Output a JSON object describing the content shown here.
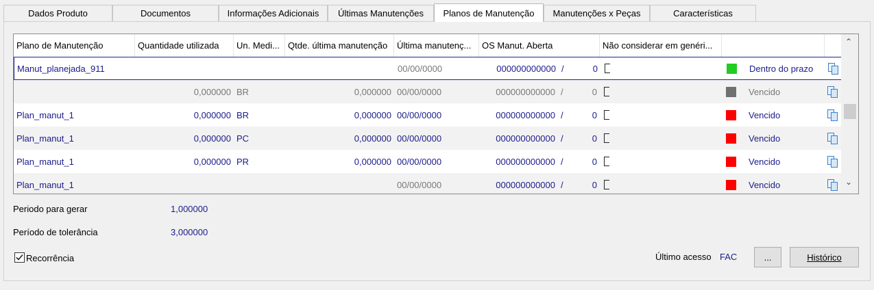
{
  "tabs": [
    {
      "label": "Dados Produto"
    },
    {
      "label": "Documentos"
    },
    {
      "label": "Informações Adicionais"
    },
    {
      "label": "Últimas Manutenções"
    },
    {
      "label": "Planos de Manutenção"
    },
    {
      "label": "Manutenções x Peças"
    },
    {
      "label": "Características"
    }
  ],
  "grid": {
    "columns": [
      "Plano de Manutenção",
      "Quantidade utilizada",
      "Un. Medi...",
      "Qtde. última manutenção",
      "Última manutenç...",
      "OS Manut. Aberta",
      "Não considerar em genéri..."
    ],
    "rows": [
      {
        "plano": "Manut_planejada_911",
        "qtd": "",
        "un": "",
        "qtde_ult": "",
        "ult_data": "00/00/0000",
        "os": "000000000000",
        "sep": "/",
        "os2": "0",
        "status": "Dentro do prazo",
        "color": "#22cc22"
      },
      {
        "plano": "",
        "qtd": "0,000000",
        "un": "BR",
        "qtde_ult": "0,000000",
        "ult_data": "00/00/0000",
        "os": "000000000000",
        "sep": "/",
        "os2": "0",
        "status": "Vencido",
        "color": "#707070"
      },
      {
        "plano": "Plan_manut_1",
        "qtd": "0,000000",
        "un": "BR",
        "qtde_ult": "0,000000",
        "ult_data": "00/00/0000",
        "os": "000000000000",
        "sep": "/",
        "os2": "0",
        "status": "Vencido",
        "color": "#ff0000"
      },
      {
        "plano": "Plan_manut_1",
        "qtd": "0,000000",
        "un": "PC",
        "qtde_ult": "0,000000",
        "ult_data": "00/00/0000",
        "os": "000000000000",
        "sep": "/",
        "os2": "0",
        "status": "Vencido",
        "color": "#ff0000"
      },
      {
        "plano": "Plan_manut_1",
        "qtd": "0,000000",
        "un": "PR",
        "qtde_ult": "0,000000",
        "ult_data": "00/00/0000",
        "os": "000000000000",
        "sep": "/",
        "os2": "0",
        "status": "Vencido",
        "color": "#ff0000"
      },
      {
        "plano": "Plan_manut_1",
        "qtd": "",
        "un": "",
        "qtde_ult": "",
        "ult_data": "00/00/0000",
        "os": "000000000000",
        "sep": "/",
        "os2": "0",
        "status": "Vencido",
        "color": "#ff0000"
      }
    ]
  },
  "form": {
    "periodo_gerar_label": "Periodo para gerar",
    "periodo_gerar_value": "1,000000",
    "periodo_tolerancia_label": "Período de tolerância",
    "periodo_tolerancia_value": "3,000000",
    "recorrencia_label": "Recorrência",
    "recorrencia_checked": true,
    "ultimo_acesso_label": "Último acesso",
    "ultimo_acesso_value": "FAC",
    "ellipsis_button": "...",
    "historico_button": "Histórico"
  },
  "colors": {
    "link": "#1a1a8c",
    "selected_border": "#1b2a8a"
  }
}
